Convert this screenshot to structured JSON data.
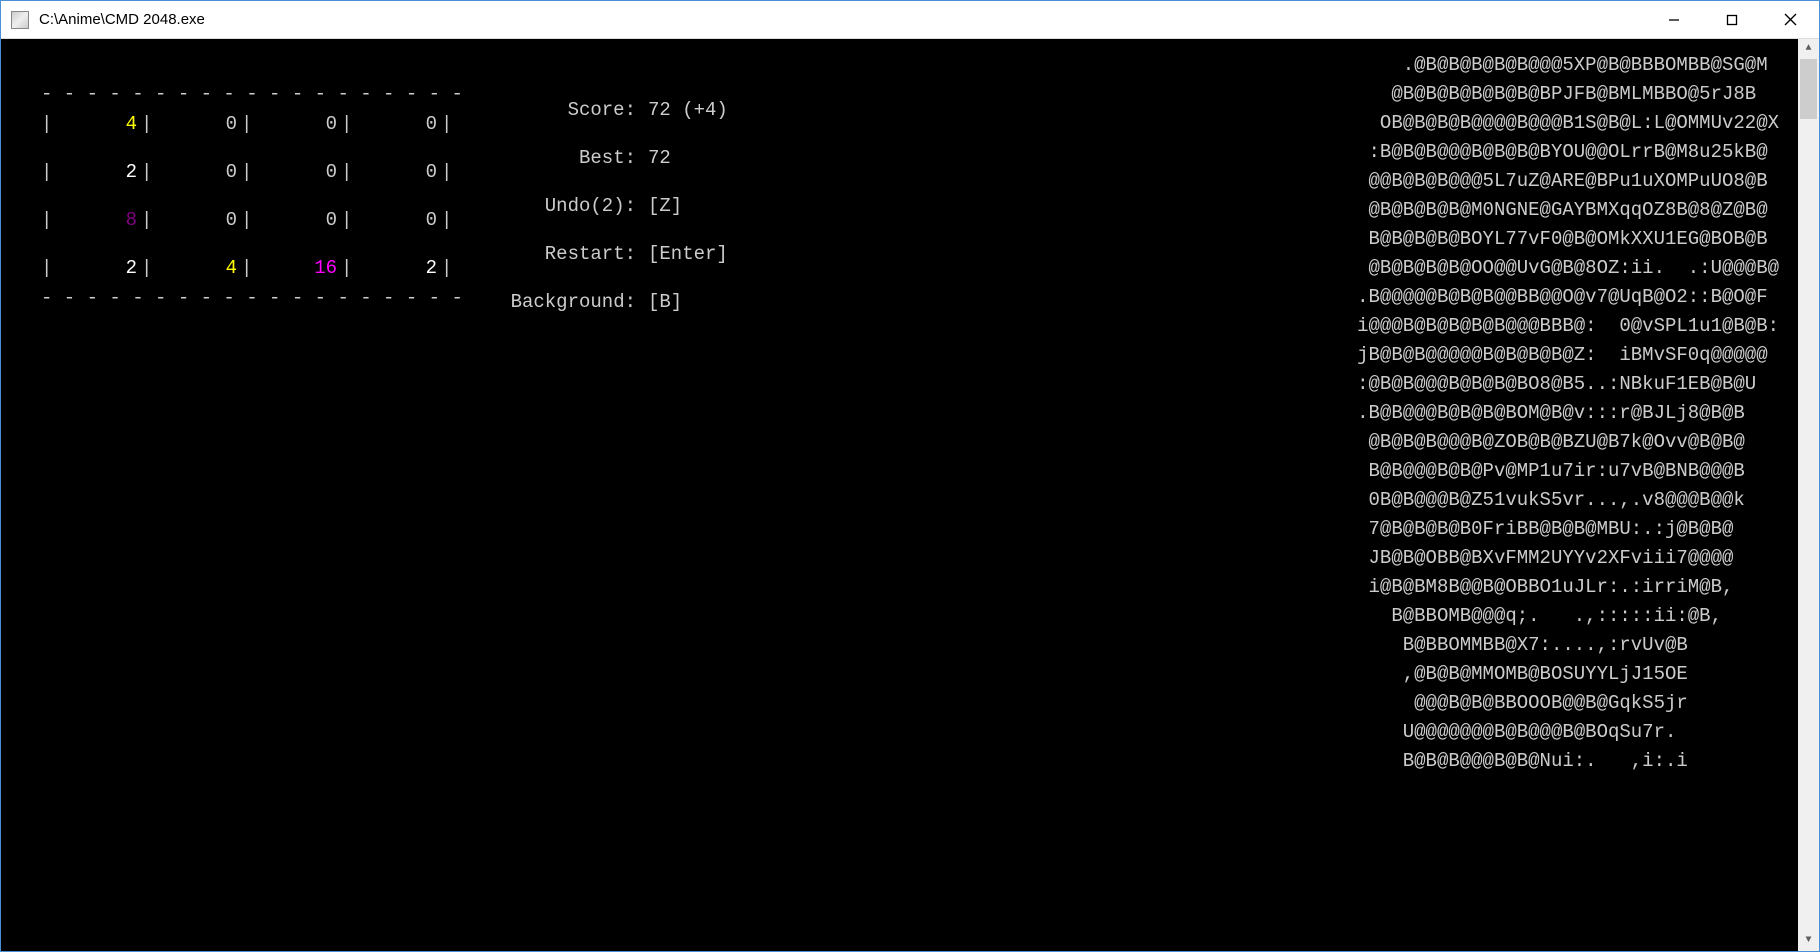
{
  "window": {
    "title": "C:\\Anime\\CMD 2048.exe"
  },
  "board": {
    "divider": " - - - - - - - - - - - - - - - - - - -",
    "cells": [
      [
        {
          "v": "4",
          "c": "c-yellow"
        },
        {
          "v": "0",
          "c": "c-gray"
        },
        {
          "v": "0",
          "c": "c-gray"
        },
        {
          "v": "0",
          "c": "c-gray"
        }
      ],
      [
        {
          "v": "2",
          "c": "c-white"
        },
        {
          "v": "0",
          "c": "c-gray"
        },
        {
          "v": "0",
          "c": "c-gray"
        },
        {
          "v": "0",
          "c": "c-gray"
        }
      ],
      [
        {
          "v": "8",
          "c": "c-dmagenta"
        },
        {
          "v": "0",
          "c": "c-gray"
        },
        {
          "v": "0",
          "c": "c-gray"
        },
        {
          "v": "0",
          "c": "c-gray"
        }
      ],
      [
        {
          "v": "2",
          "c": "c-white"
        },
        {
          "v": "4",
          "c": "c-yellow"
        },
        {
          "v": "16",
          "c": "c-magenta"
        },
        {
          "v": "2",
          "c": "c-white"
        }
      ]
    ]
  },
  "status": {
    "score_label": "Score:",
    "score_value": "72 (+4)",
    "best_label": "Best:",
    "best_value": "72",
    "undo_label": "Undo(2):",
    "undo_value": "[Z]",
    "restart_label": "Restart:",
    "restart_value": "[Enter]",
    "background_label": "Background:",
    "background_value": "[B]"
  },
  "ascii_art": [
    "    .@B@B@B@B@B@@@5XP@B@BBBOMBB@SG@M",
    "   @B@B@B@B@B@B@BPJFB@BMLMBBO@5rJ8B",
    "  OB@B@B@B@@@@B@@@B1S@B@L:L@OMMUv22@X",
    " :B@B@B@@@B@B@B@BYOU@@OLrrB@M8u25kB@",
    " @@B@B@B@@@5L7uZ@ARE@BPu1uXOMPuUO8@B",
    " @B@B@B@B@M0NGNE@GAYBMXqqOZ8B@8@Z@B@",
    " B@B@B@B@BOYL77vF0@B@OMkXXU1EG@BOB@B",
    " @B@B@B@B@OO@@UvG@B@8OZ:ii.  .:U@@@B@",
    ".B@@@@@B@B@B@@BB@@O@v7@UqB@O2::B@O@F",
    "i@@@B@B@B@B@B@@@BBB@:  0@vSPL1u1@B@B:",
    "jB@B@B@@@@@B@B@B@B@Z:  iBMvSF0q@@@@@",
    ":@B@B@@@B@B@B@BO8@B5..:NBkuF1EB@B@U",
    ".B@B@@@B@B@B@BOM@B@v:::r@BJLj8@B@B",
    " @B@B@B@@@B@ZOB@B@BZU@B7k@Ovv@B@B@",
    " B@B@@@B@B@Pv@MP1u7ir:u7vB@BNB@@@B",
    " 0B@B@@@B@Z51vukS5vr...,.v8@@@B@@k",
    " 7@B@B@B@B0FriBB@B@B@MBU:.:j@B@B@",
    " JB@B@OBB@BXvFMM2UYYv2XFviii7@@@@",
    " i@B@BM8B@@B@OBBO1uJLr:.:irriM@B,",
    "   B@BBOMB@@@q;.   .,:::::ii:@B,",
    "    B@BBOMMBB@X7:....,:rvUv@B",
    "    ,@B@B@MMOMB@BOSUYYLjJ15OE",
    "     @@@B@B@BBOOOB@@B@GqkS5jr",
    "    U@@@@@@@B@B@@@B@BOqSu7r.",
    "    B@B@B@@@B@B@Nui:.   ,i:.i"
  ]
}
